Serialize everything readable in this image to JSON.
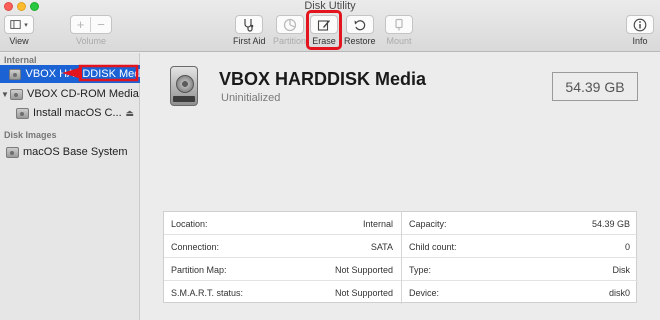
{
  "window": {
    "title": "Disk Utility"
  },
  "toolbar": {
    "view_label": "View",
    "volume_label": "Volume",
    "first_aid_label": "First Aid",
    "partition_label": "Partition",
    "erase_label": "Erase",
    "restore_label": "Restore",
    "mount_label": "Mount",
    "info_label": "Info",
    "volume_add_glyph": "+",
    "volume_remove_glyph": "−"
  },
  "sidebar": {
    "internal_header": "Internal",
    "disk_images_header": "Disk Images",
    "items": [
      {
        "label": "VBOX HARDDISK Media",
        "selected": true,
        "icon": "hard-disk-icon"
      },
      {
        "label": "VBOX CD-ROM Media",
        "icon": "optical-disk-icon"
      },
      {
        "label": "Install macOS C...",
        "icon": "volume-icon"
      },
      {
        "label": "macOS Base System",
        "icon": "volume-icon"
      }
    ]
  },
  "main": {
    "disk_name": "VBOX HARDDISK Media",
    "disk_status": "Uninitialized",
    "size": "54.39 GB"
  },
  "info": {
    "left": [
      {
        "key": "Location:",
        "value": "Internal"
      },
      {
        "key": "Connection:",
        "value": "SATA"
      },
      {
        "key": "Partition Map:",
        "value": "Not Supported"
      },
      {
        "key": "S.M.A.R.T. status:",
        "value": "Not Supported"
      }
    ],
    "right": [
      {
        "key": "Capacity:",
        "value": "54.39 GB"
      },
      {
        "key": "Child count:",
        "value": "0"
      },
      {
        "key": "Type:",
        "value": "Disk"
      },
      {
        "key": "Device:",
        "value": "disk0"
      }
    ]
  },
  "colors": {
    "selection": "#1b63d4",
    "annotation_red": "#e3141d"
  }
}
